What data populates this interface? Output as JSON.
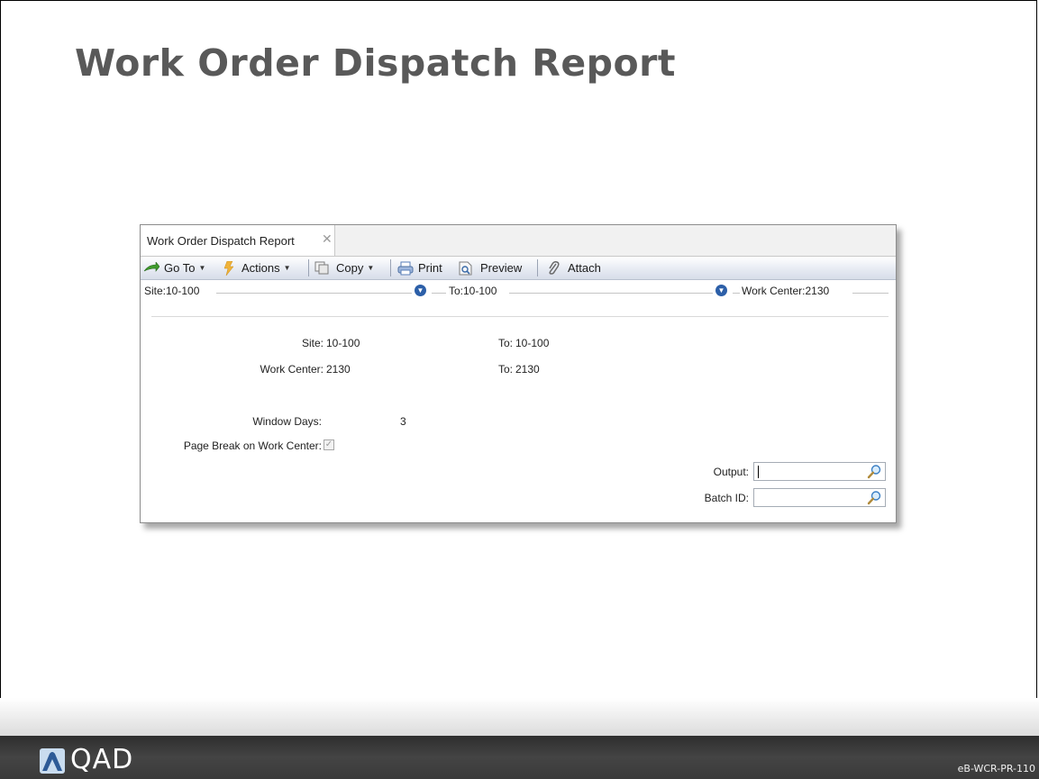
{
  "slide": {
    "title": "Work Order Dispatch Report",
    "footer_brand": "QAD",
    "footer_code": "eB-WCR-PR-110"
  },
  "window": {
    "tab_label": "Work Order Dispatch Report",
    "tab_close": "✕",
    "toolbar": {
      "goto_label": "Go To",
      "actions_label": "Actions",
      "copy_label": "Copy",
      "print_label": "Print",
      "preview_label": "Preview",
      "attach_label": "Attach"
    },
    "filter": {
      "site": "Site:10-100",
      "to_site": "To:10-100",
      "work_center": "Work Center:2130"
    },
    "form": {
      "site_label": "Site:",
      "site_value": "10-100",
      "site_to_label": "To:",
      "site_to_value": "10-100",
      "wc_label": "Work Center:",
      "wc_value": "2130",
      "wc_to_label": "To:",
      "wc_to_value": "2130",
      "window_days_label": "Window Days:",
      "window_days_value": "3",
      "page_break_label": "Page Break on Work Center:",
      "page_break_checked": true,
      "output_label": "Output:",
      "output_value": "",
      "batch_label": "Batch ID:",
      "batch_value": ""
    }
  },
  "colors": {
    "title": "#595959",
    "footer_bg": "#3a3a3a",
    "toolbar_bg": "#e7ebf3",
    "filter_button": "#2c5fa8"
  }
}
